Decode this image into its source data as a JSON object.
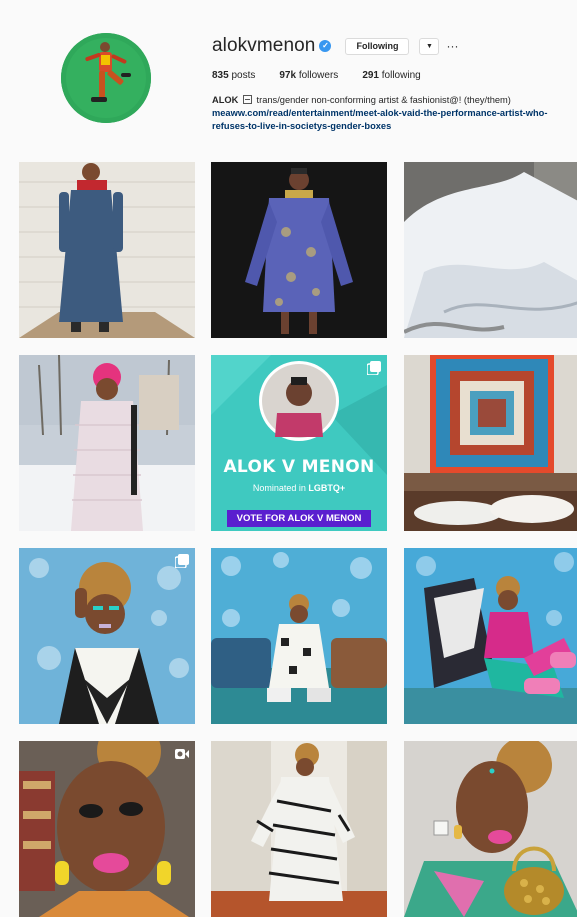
{
  "profile": {
    "username": "alokvmenon",
    "verified_glyph": "✓",
    "following_label": "Following",
    "dropdown_glyph": "▼",
    "more_glyph": "···",
    "stats": [
      {
        "count": "835",
        "label": " posts"
      },
      {
        "count": "97k",
        "label": " followers"
      },
      {
        "count": "291",
        "label": " following"
      }
    ],
    "bio": {
      "name": "ALOK",
      "text": " trans/gender non-conforming artist & fashionist@! (they/them)",
      "link": "meaww.com/read/entertainment/meet-alok-vaid-the-performance-artist-who-refuses-to-live-in-societys-gender-boxes"
    }
  },
  "posts": [
    {
      "id": "post-denim-dress",
      "badge": null
    },
    {
      "id": "post-purple-brocade",
      "badge": null
    },
    {
      "id": "post-snow",
      "badge": null
    },
    {
      "id": "post-pink-puffer",
      "badge": null
    },
    {
      "id": "post-vote-graphic",
      "badge": "carousel"
    },
    {
      "id": "post-quilt-art",
      "badge": null
    },
    {
      "id": "post-blue-floral-portrait",
      "badge": "carousel"
    },
    {
      "id": "post-floral-sofa",
      "badge": null
    },
    {
      "id": "post-pink-sneakers",
      "badge": null
    },
    {
      "id": "post-closeup-makeup",
      "badge": "video"
    },
    {
      "id": "post-zebra-gown",
      "badge": null
    },
    {
      "id": "post-gold-bag",
      "badge": null
    }
  ],
  "vote_post": {
    "title": "ALOK V MENON",
    "sub_prefix": "Nominated in ",
    "sub_category": "LGBTQ+",
    "button": "VOTE FOR ALOK V MENON"
  },
  "colors": {
    "link": "#003569",
    "verified": "#3897f0",
    "vote_button": "#5a1fcf",
    "vote_bg": "#3fc9c0"
  }
}
